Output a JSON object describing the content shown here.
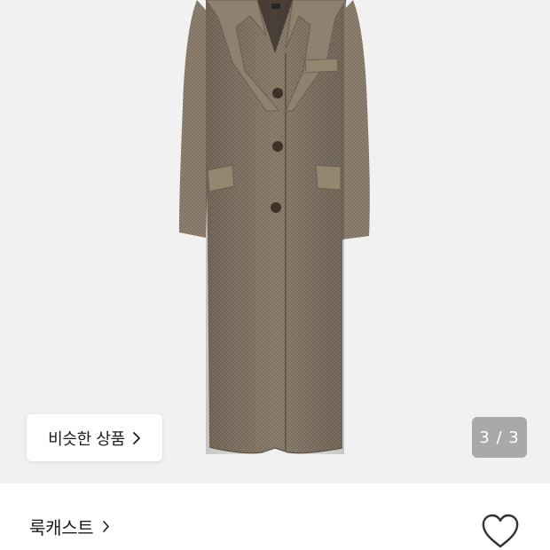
{
  "gallery": {
    "image_icon": "wool-long-coat-product-photo",
    "similar_label": "비슷한 상품",
    "counter": "3 / 3",
    "background": "#f1f1f1",
    "coat_color": "#8b7d6d"
  },
  "store": {
    "name": "룩캐스트",
    "chevron_icon": "chevron-right-icon",
    "like_icon": "heart-outline-icon"
  }
}
